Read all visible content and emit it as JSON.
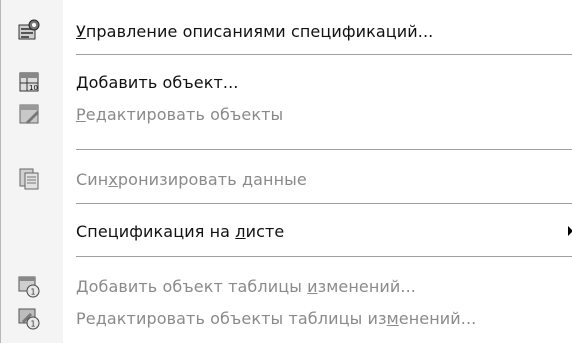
{
  "menu": {
    "items": [
      {
        "pre": "",
        "u": "У",
        "post": "правление описаниями спецификаций...",
        "icon": "spec-description-icon",
        "disabled": false
      },
      {
        "pre": "",
        "u": "Д",
        "post": "обавить объект...",
        "icon": "add-object-icon",
        "disabled": false
      },
      {
        "pre": "",
        "u": "Р",
        "post": "едактировать объекты",
        "icon": "edit-objects-icon",
        "disabled": true
      },
      {
        "pre": "Син",
        "u": "х",
        "post": "ронизировать данные",
        "icon": "sync-data-icon",
        "disabled": true
      },
      {
        "pre": "Спецификация на ",
        "u": "л",
        "post": "исте",
        "icon": "",
        "disabled": false,
        "submenu": true
      },
      {
        "pre": "Добавить объект таблицы ",
        "u": "и",
        "post": "зменений...",
        "icon": "add-change-table-object-icon",
        "disabled": true
      },
      {
        "pre": "Редактировать объекты таблицы из",
        "u": "м",
        "post": "енений...",
        "icon": "edit-change-table-objects-icon",
        "disabled": true
      }
    ]
  }
}
